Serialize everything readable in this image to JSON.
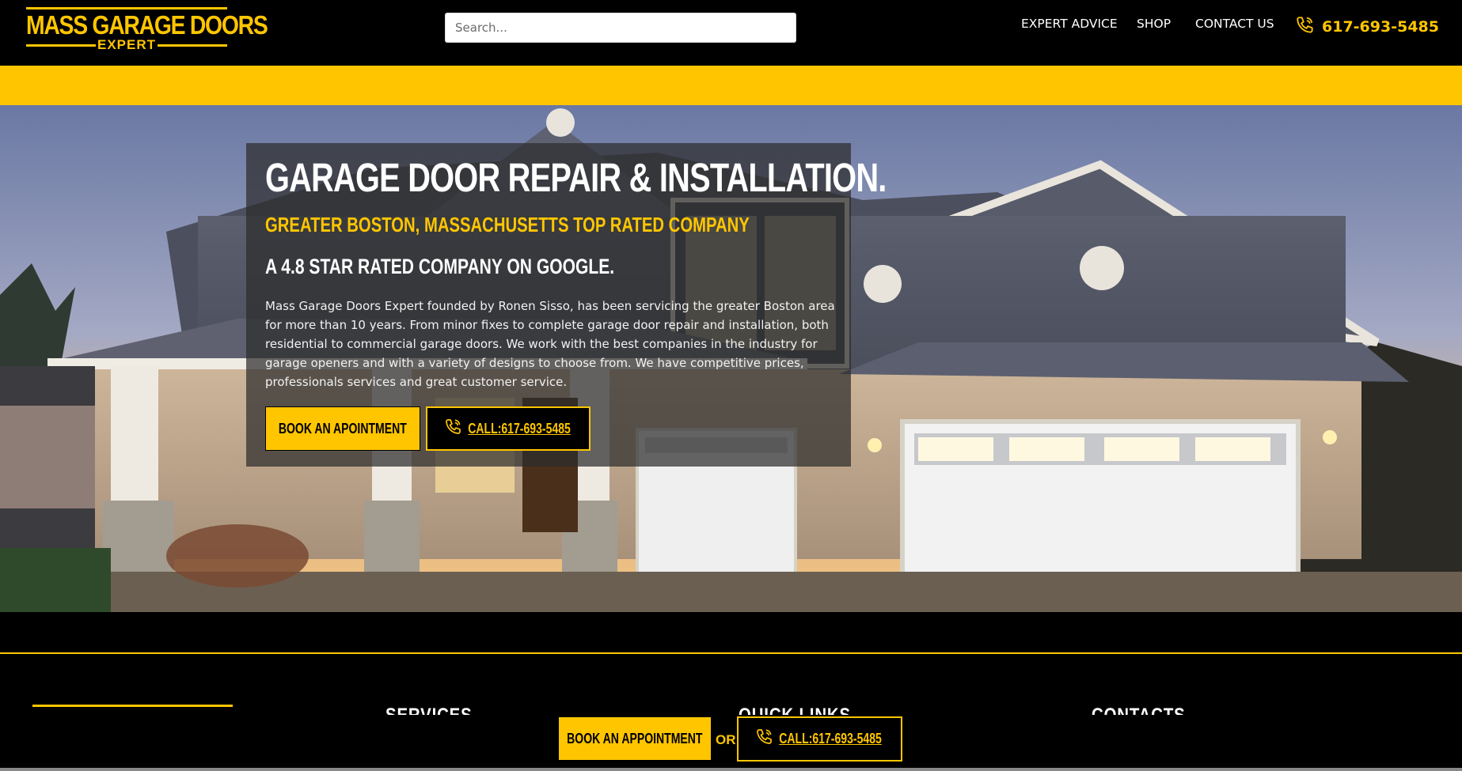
{
  "header": {
    "logo": {
      "main": "MASS GARAGE DOORS",
      "sub": "EXPERT"
    },
    "search": {
      "placeholder": "Search..."
    },
    "nav": [
      {
        "label": "EXPERT ADVICE"
      },
      {
        "label": "SHOP"
      },
      {
        "label": "CONTACT US"
      }
    ],
    "phone": {
      "label": "617-693-5485",
      "icon": "phone-icon"
    }
  },
  "hero": {
    "title": "GARAGE DOOR REPAIR & INSTALLATION.",
    "subtitle": "GREATER BOSTON, MASSACHUSETTS TOP RATED COMPANY",
    "rating": "A 4.8 STAR RATED COMPANY ON GOOGLE.",
    "description": "Mass Garage Doors Expert founded by Ronen Sisso, has been servicing the greater Boston area for more than 10 years. From minor fixes to complete garage door repair and installation, both residential to commercial garage doors. We work with the best companies in the industry for garage openers and with a variety of designs to choose from. We have competitive prices, professionals services and great customer service.",
    "book_label": "BOOK AN APOINTMENT",
    "call_label": "CALL:617-693-5485"
  },
  "footer": {
    "headings": [
      "SERVICES",
      "QUICK LINKS",
      "CONTACTS"
    ]
  },
  "sticky": {
    "book_label": "BOOK AN APPOINTMENT",
    "or_label": "OR",
    "call_label": "CALL:617-693-5485"
  },
  "colors": {
    "accent": "#ffc600",
    "background": "#000000",
    "overlay": "#2d2d2d"
  }
}
